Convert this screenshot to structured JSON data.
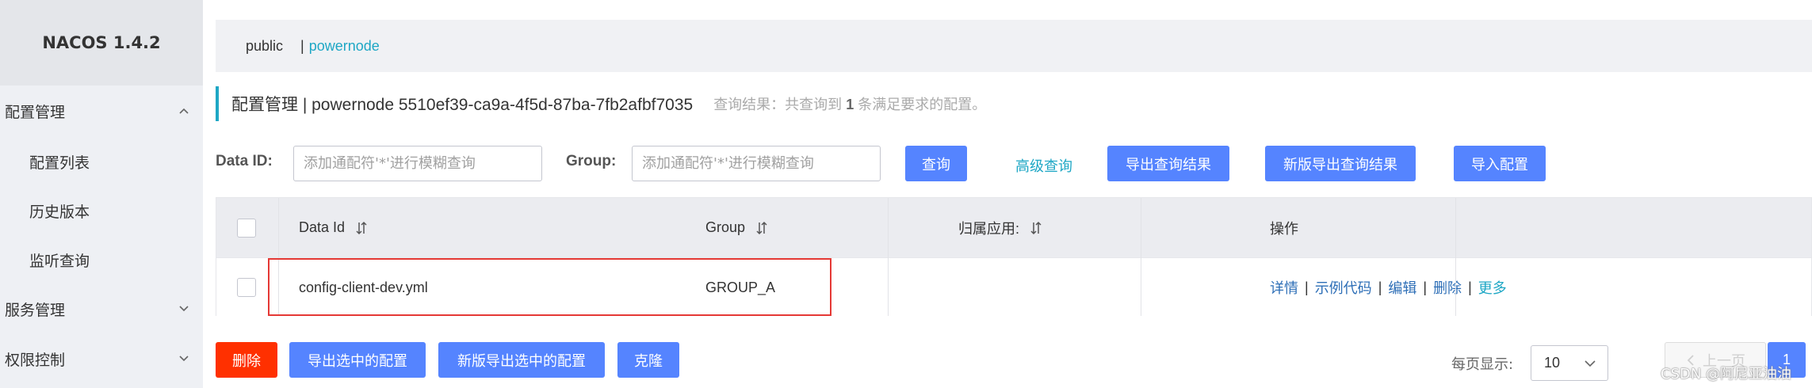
{
  "app": {
    "logo": "NACOS 1.4.2"
  },
  "sidebar": {
    "groups": [
      {
        "label": "配置管理",
        "expanded": true
      },
      {
        "label": "服务管理",
        "expanded": false
      },
      {
        "label": "权限控制",
        "expanded": false
      }
    ],
    "items": [
      {
        "label": "配置列表"
      },
      {
        "label": "历史版本"
      },
      {
        "label": "监听查询"
      }
    ]
  },
  "namespace": {
    "public": "public",
    "separator": "|",
    "active": "powernode"
  },
  "header": {
    "title": "配置管理 | powernode 5510ef39-ca9a-4f5d-87ba-7fb2afbf7035",
    "result_prefix": "查询结果：共查询到",
    "result_count": "1",
    "result_suffix": "条满足要求的配置。"
  },
  "filters": {
    "data_id_label": "Data ID:",
    "data_id_placeholder": "添加通配符'*'进行模糊查询",
    "group_label": "Group:",
    "group_placeholder": "添加通配符'*'进行模糊查询",
    "search_button": "查询",
    "advanced_link": "高级查询",
    "export_button": "导出查询结果",
    "new_export_button": "新版导出查询结果",
    "import_button": "导入配置"
  },
  "table": {
    "columns": [
      "Data Id",
      "Group",
      "归属应用:",
      "操作"
    ],
    "rows": [
      {
        "data_id": "config-client-dev.yml",
        "group": "GROUP_A",
        "app": "",
        "actions": [
          "详情",
          "示例代码",
          "编辑",
          "删除",
          "更多"
        ]
      }
    ]
  },
  "bulk_actions": {
    "delete": "删除",
    "export_selected": "导出选中的配置",
    "new_export_selected": "新版导出选中的配置",
    "clone": "克隆"
  },
  "pagination": {
    "page_size_label": "每页显示:",
    "page_size": "10",
    "prev": "上一页",
    "current_page": "1"
  },
  "watermark": "CSDN @阿尼亚油油",
  "colors": {
    "primary": "#5584ff",
    "danger": "#ff3000",
    "accent": "#1ea7c5",
    "link": "#2e6fb7",
    "highlight_border": "#e53935"
  },
  "icons": [
    "chevron-up-icon",
    "chevron-down-icon",
    "sort-icon",
    "chevron-left-icon"
  ]
}
